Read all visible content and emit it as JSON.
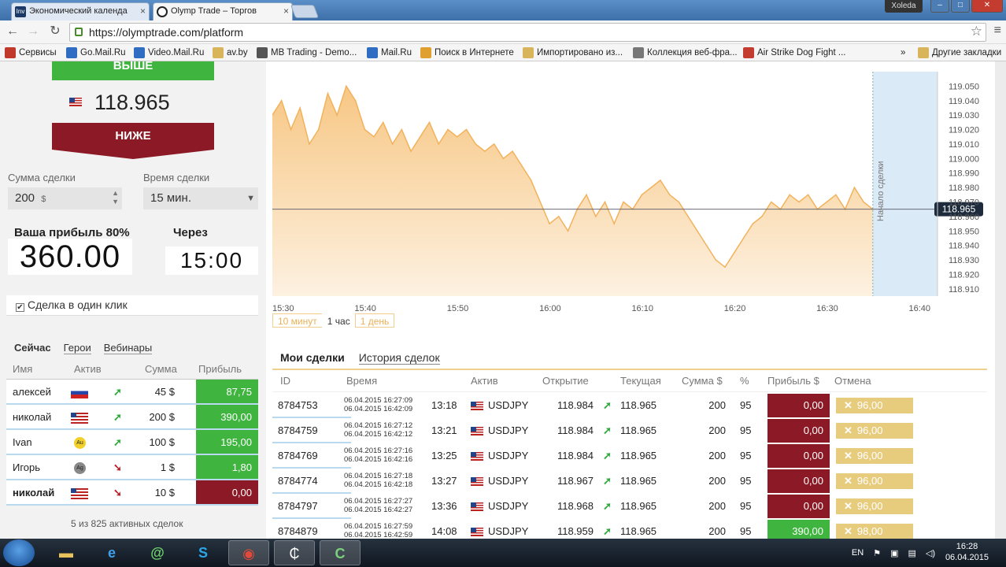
{
  "browser": {
    "tabs": [
      {
        "title": "Экономический календа",
        "icon": "investing-icon",
        "icon_text": "Inv",
        "icon_color": "#1b3966"
      },
      {
        "title": "Olymp Trade – Торгов",
        "icon": "olymp-icon",
        "icon_text": "",
        "icon_color": "#222222"
      }
    ],
    "user": "Xoleda",
    "url": "https://olymptrade.com/platform",
    "bookmarks": [
      {
        "label": "Сервисы",
        "icon": "apps-icon"
      },
      {
        "label": "Go.Mail.Ru",
        "icon": "gomail-icon"
      },
      {
        "label": "Video.Mail.Ru",
        "icon": "video-icon"
      },
      {
        "label": "av.by",
        "icon": "folder-icon"
      },
      {
        "label": "MB Trading - Demo...",
        "icon": "mb-icon"
      },
      {
        "label": "Mail.Ru",
        "icon": "mail-icon"
      },
      {
        "label": "Поиск в Интернете",
        "icon": "search-icon"
      },
      {
        "label": "Импортировано из...",
        "icon": "folder-icon"
      },
      {
        "label": "Коллекция веб-фра...",
        "icon": "page-icon"
      },
      {
        "label": "Air Strike Dog Fight ...",
        "icon": "game-icon"
      },
      {
        "label": "»",
        "icon": "more-icon"
      },
      {
        "label": "Другие закладки",
        "icon": "folder-icon"
      }
    ]
  },
  "left": {
    "up_label": "ВЫШЕ",
    "price": "118.965",
    "down_label": "НИЖЕ",
    "amount_label": "Сумма сделки",
    "amount_value": "200",
    "amount_currency": "$",
    "time_label": "Время сделки",
    "time_value": "15 мин.",
    "profit_label": "Ваша прибыль 80%",
    "profit_value": "360.00",
    "through_label": "Через",
    "through_value": "15:00",
    "oneclick_label": "Сделка в один клик",
    "oneclick_mark": "✔",
    "tabs": [
      "Сейчас",
      "Герои",
      "Вебинары"
    ],
    "table_headers": [
      "Имя",
      "Актив",
      "Сумма",
      "Прибыль"
    ],
    "rows": [
      {
        "name": "алексей",
        "asset": "ru",
        "dir": "up",
        "dir_glyph": "➚",
        "sum": "45 $",
        "profit": "87,75",
        "color": "#3fb53f"
      },
      {
        "name": "николай",
        "asset": "us",
        "dir": "up",
        "dir_glyph": "➚",
        "sum": "200 $",
        "profit": "390,00",
        "color": "#3fb53f"
      },
      {
        "name": "Ivan",
        "asset": "Au",
        "dir": "up",
        "dir_glyph": "➚",
        "sum": "100 $",
        "profit": "195,00",
        "color": "#3fb53f"
      },
      {
        "name": "Игорь",
        "asset": "Ag",
        "dir": "down",
        "dir_glyph": "➘",
        "sum": "1 $",
        "profit": "1,80",
        "color": "#3fb53f"
      },
      {
        "name": "николай",
        "asset": "us",
        "dir": "down",
        "dir_glyph": "➘",
        "sum": "10 $",
        "profit": "0,00",
        "color": "#8c1a26"
      }
    ],
    "active_count": "5 из 825 активных сделок"
  },
  "chart_data": {
    "type": "area",
    "x_ticks": [
      "15:30",
      "15:40",
      "15:50",
      "16:00",
      "16:10",
      "16:20",
      "16:30",
      "16:40"
    ],
    "y_ticks": [
      "119.050",
      "119.040",
      "119.030",
      "119.020",
      "119.010",
      "119.000",
      "118.990",
      "118.980",
      "118.970",
      "118.960",
      "118.950",
      "118.940",
      "118.930",
      "118.920",
      "118.910"
    ],
    "ylim": [
      118.905,
      119.06
    ],
    "x_start_minutes": 0,
    "x_end_minutes": 72,
    "series": [
      {
        "values": [
          [
            0,
            119.03
          ],
          [
            1,
            119.04
          ],
          [
            2,
            119.02
          ],
          [
            3,
            119.035
          ],
          [
            4,
            119.01
          ],
          [
            5,
            119.02
          ],
          [
            6,
            119.045
          ],
          [
            7,
            119.03
          ],
          [
            8,
            119.05
          ],
          [
            9,
            119.04
          ],
          [
            10,
            119.02
          ],
          [
            11,
            119.015
          ],
          [
            12,
            119.025
          ],
          [
            13,
            119.01
          ],
          [
            14,
            119.02
          ],
          [
            15,
            119.005
          ],
          [
            16,
            119.015
          ],
          [
            17,
            119.025
          ],
          [
            18,
            119.01
          ],
          [
            19,
            119.02
          ],
          [
            20,
            119.015
          ],
          [
            21,
            119.02
          ],
          [
            22,
            119.01
          ],
          [
            23,
            119.005
          ],
          [
            24,
            119.01
          ],
          [
            25,
            119.0
          ],
          [
            26,
            119.005
          ],
          [
            27,
            118.995
          ],
          [
            28,
            118.985
          ],
          [
            29,
            118.97
          ],
          [
            30,
            118.955
          ],
          [
            31,
            118.96
          ],
          [
            32,
            118.95
          ],
          [
            33,
            118.965
          ],
          [
            34,
            118.975
          ],
          [
            35,
            118.96
          ],
          [
            36,
            118.97
          ],
          [
            37,
            118.955
          ],
          [
            38,
            118.97
          ],
          [
            39,
            118.965
          ],
          [
            40,
            118.975
          ],
          [
            41,
            118.98
          ],
          [
            42,
            118.985
          ],
          [
            43,
            118.975
          ],
          [
            44,
            118.97
          ],
          [
            45,
            118.96
          ],
          [
            46,
            118.95
          ],
          [
            47,
            118.94
          ],
          [
            48,
            118.93
          ],
          [
            49,
            118.925
          ],
          [
            50,
            118.935
          ],
          [
            51,
            118.945
          ],
          [
            52,
            118.955
          ],
          [
            53,
            118.96
          ],
          [
            54,
            118.97
          ],
          [
            55,
            118.965
          ],
          [
            56,
            118.975
          ],
          [
            57,
            118.97
          ],
          [
            58,
            118.975
          ],
          [
            59,
            118.965
          ],
          [
            60,
            118.97
          ],
          [
            61,
            118.975
          ],
          [
            62,
            118.965
          ],
          [
            63,
            118.98
          ],
          [
            64,
            118.97
          ],
          [
            65,
            118.965
          ]
        ]
      }
    ],
    "current_value": "118.965",
    "deal_start_label": "Начало сделки",
    "deal_start_x": 65,
    "colors": {
      "fill": "#f7c784",
      "line": "#f2b25c",
      "future": "#dbeaf7"
    }
  },
  "ranges": [
    "10 минут",
    "1 час",
    "1 день"
  ],
  "range_active": 1,
  "trades": {
    "tabs": [
      "Мои сделки",
      "История сделок"
    ],
    "headers": [
      "ID",
      "Время",
      "Актив",
      "Открытие",
      "Текущая",
      "Сумма $",
      "%",
      "Прибыль $",
      "Отмена"
    ],
    "rows": [
      {
        "id": "8784753",
        "t1": "06.04.2015 16:27:09",
        "t2": "06.04.2015 16:42:09",
        "left": "13:18",
        "asset": "USDJPY",
        "open": "118.984",
        "cur": "118.965",
        "sum": "200",
        "pct": "95",
        "profit": "0,00",
        "pcolor": "#8c1a26",
        "cancel": "96,00"
      },
      {
        "id": "8784759",
        "t1": "06.04.2015 16:27:12",
        "t2": "06.04.2015 16:42:12",
        "left": "13:21",
        "asset": "USDJPY",
        "open": "118.984",
        "cur": "118.965",
        "sum": "200",
        "pct": "95",
        "profit": "0,00",
        "pcolor": "#8c1a26",
        "cancel": "96,00"
      },
      {
        "id": "8784769",
        "t1": "06.04.2015 16:27:16",
        "t2": "06.04.2015 16:42:16",
        "left": "13:25",
        "asset": "USDJPY",
        "open": "118.984",
        "cur": "118.965",
        "sum": "200",
        "pct": "95",
        "profit": "0,00",
        "pcolor": "#8c1a26",
        "cancel": "96,00"
      },
      {
        "id": "8784774",
        "t1": "06.04.2015 16:27:18",
        "t2": "06.04.2015 16:42:18",
        "left": "13:27",
        "asset": "USDJPY",
        "open": "118.967",
        "cur": "118.965",
        "sum": "200",
        "pct": "95",
        "profit": "0,00",
        "pcolor": "#8c1a26",
        "cancel": "96,00"
      },
      {
        "id": "8784797",
        "t1": "06.04.2015 16:27:27",
        "t2": "06.04.2015 16:42:27",
        "left": "13:36",
        "asset": "USDJPY",
        "open": "118.968",
        "cur": "118.965",
        "sum": "200",
        "pct": "95",
        "profit": "0,00",
        "pcolor": "#8c1a26",
        "cancel": "96,00"
      },
      {
        "id": "8784879",
        "t1": "06.04.2015 16:27:59",
        "t2": "06.04.2015 16:42:59",
        "left": "14:08",
        "asset": "USDJPY",
        "open": "118.959",
        "cur": "118.965",
        "sum": "200",
        "pct": "95",
        "profit": "390,00",
        "pcolor": "#3fb53f",
        "cancel": "98,00"
      }
    ]
  },
  "taskbar": {
    "lang": "EN",
    "time": "16:28",
    "date": "06.04.2015"
  }
}
